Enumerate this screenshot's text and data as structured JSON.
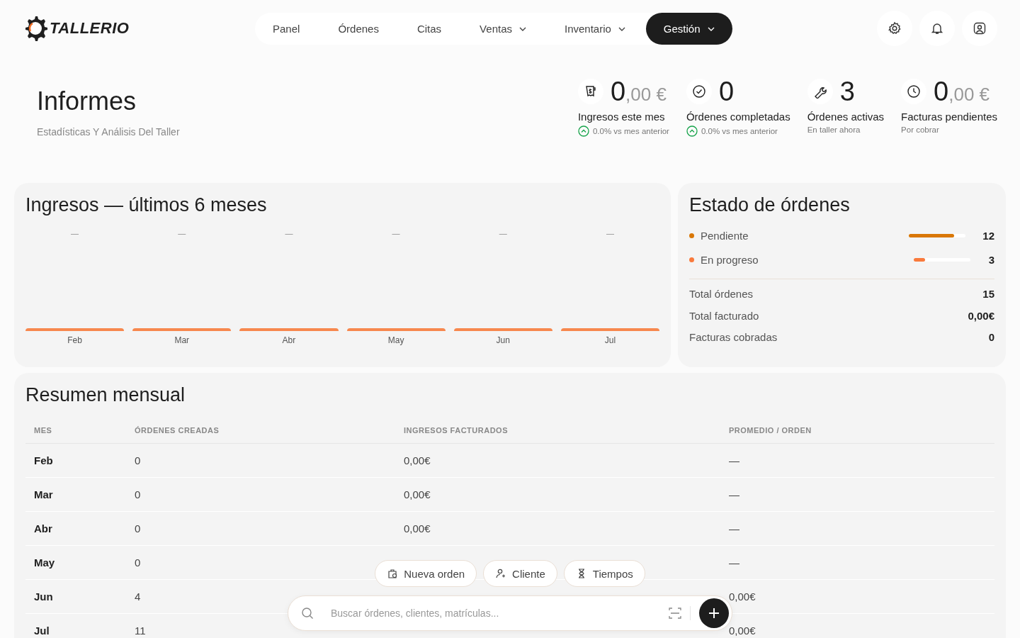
{
  "brand": {
    "name": "TALLERIO"
  },
  "nav": [
    {
      "label": "Panel",
      "dropdown": false,
      "selected": false
    },
    {
      "label": "Órdenes",
      "dropdown": false,
      "selected": false
    },
    {
      "label": "Citas",
      "dropdown": false,
      "selected": false
    },
    {
      "label": "Ventas",
      "dropdown": true,
      "selected": false
    },
    {
      "label": "Inventario",
      "dropdown": true,
      "selected": false
    },
    {
      "label": "Gestión",
      "dropdown": true,
      "selected": true
    }
  ],
  "page": {
    "title": "Informes",
    "subtitle": "Estadísticas Y Análisis Del Taller"
  },
  "stats": [
    {
      "value": "0",
      "decimals": ",00 €",
      "label": "Ingresos este mes",
      "kind": "trend",
      "note": "0.0% vs mes anterior"
    },
    {
      "value": "0",
      "label": "Órdenes completadas",
      "kind": "trend",
      "note": "0.0% vs mes anterior"
    },
    {
      "value": "3",
      "label": "Órdenes activas",
      "kind": "note",
      "note": "En taller ahora"
    },
    {
      "value": "0",
      "decimals": ",00 €",
      "label": "Facturas pendientes",
      "kind": "note",
      "note": "Por cobrar"
    }
  ],
  "revenue_chart": {
    "title": "Ingresos — últimos 6 meses",
    "months": [
      {
        "label": "Feb",
        "value_label": "—"
      },
      {
        "label": "Mar",
        "value_label": "—"
      },
      {
        "label": "Abr",
        "value_label": "—"
      },
      {
        "label": "May",
        "value_label": "—"
      },
      {
        "label": "Jun",
        "value_label": "—"
      },
      {
        "label": "Jul",
        "value_label": "—"
      }
    ]
  },
  "status": {
    "title": "Estado de órdenes",
    "items": [
      {
        "label": "Pendiente",
        "color": "#d97706",
        "level": 0.8,
        "count": "12"
      },
      {
        "label": "En progreso",
        "color": "#f97a3c",
        "level": 0.2,
        "count": "3"
      }
    ],
    "totals": [
      {
        "label": "Total órdenes",
        "value": "15"
      },
      {
        "label": "Total facturado",
        "value": "0,00€"
      },
      {
        "label": "Facturas cobradas",
        "value": "0"
      }
    ]
  },
  "monthly": {
    "title": "Resumen mensual",
    "columns": [
      "MES",
      "ÓRDENES CREADAS",
      "INGRESOS FACTURADOS",
      "PROMEDIO / ORDEN"
    ],
    "rows": [
      {
        "month": "Feb",
        "created": "0",
        "billed": "0,00€",
        "average": "—"
      },
      {
        "month": "Mar",
        "created": "0",
        "billed": "0,00€",
        "average": "—"
      },
      {
        "month": "Abr",
        "created": "0",
        "billed": "0,00€",
        "average": "—"
      },
      {
        "month": "May",
        "created": "0",
        "average": "—"
      },
      {
        "month": "Jun",
        "created": "4",
        "average": "0,00€"
      },
      {
        "month": "Jul",
        "created": "11",
        "average": "0,00€"
      }
    ]
  },
  "quick_actions": [
    {
      "label": "Nueva orden"
    },
    {
      "label": "Cliente"
    },
    {
      "label": "Tiempos"
    }
  ],
  "search": {
    "placeholder": "Buscar órdenes, clientes, matrículas..."
  }
}
